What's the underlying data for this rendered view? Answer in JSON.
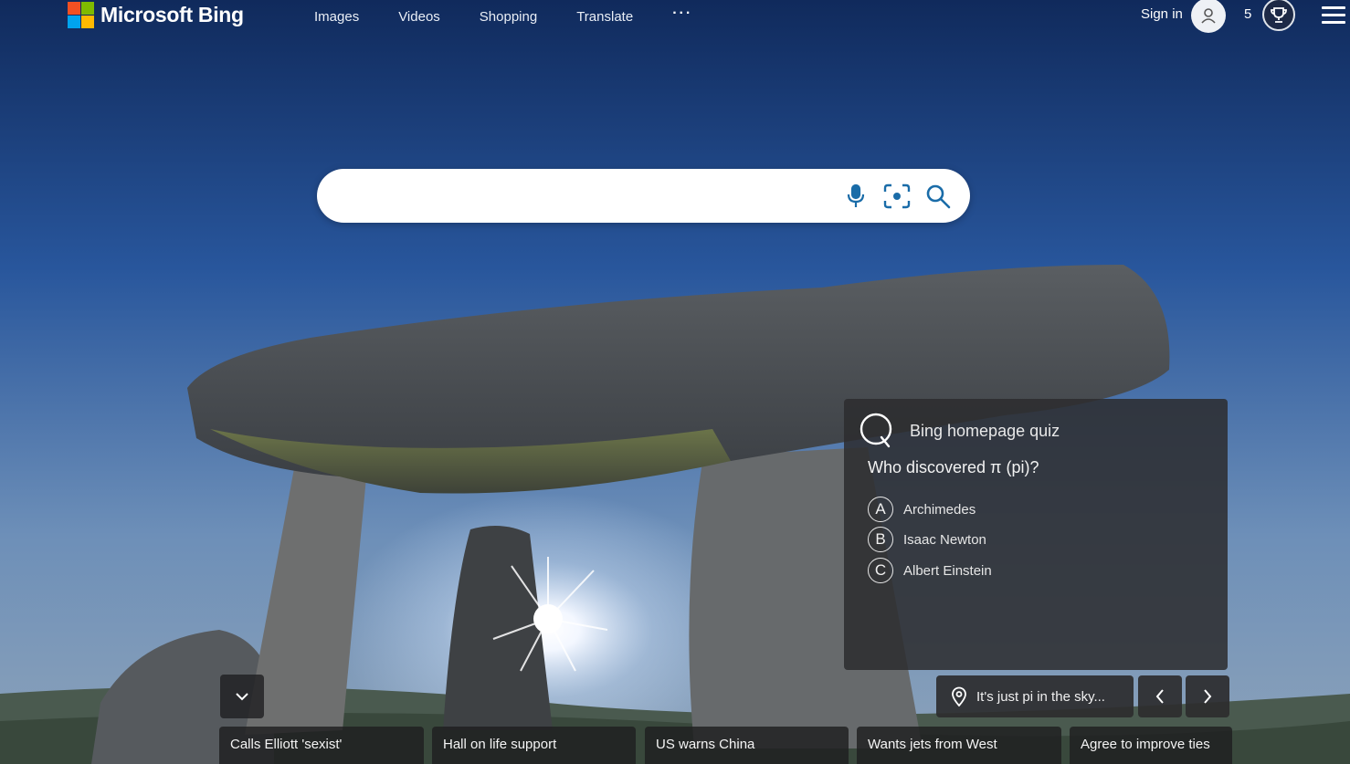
{
  "header": {
    "logo_text": "Microsoft Bing",
    "nav": [
      "Images",
      "Videos",
      "Shopping",
      "Translate"
    ],
    "more_label": "···",
    "signin_label": "Sign in",
    "rewards_points": "5"
  },
  "search": {
    "value": "",
    "placeholder": ""
  },
  "quiz": {
    "title": "Bing homepage quiz",
    "question": "Who discovered π (pi)?",
    "options": [
      {
        "letter": "A",
        "text": "Archimedes"
      },
      {
        "letter": "B",
        "text": "Isaac Newton"
      },
      {
        "letter": "C",
        "text": "Albert Einstein"
      }
    ]
  },
  "image_info": {
    "caption": "It's just pi in the sky..."
  },
  "news": [
    "Calls Elliott 'sexist'",
    "Hall on life support",
    "US warns China",
    "Wants jets from West",
    "Agree to improve ties"
  ],
  "colors": {
    "accent": "#1a6ca8",
    "ms_red": "#f25022",
    "ms_green": "#7fba00",
    "ms_blue": "#00a4ef",
    "ms_yellow": "#ffb900"
  },
  "icons": {
    "logo": "microsoft-logo-icon",
    "user": "user-icon",
    "rewards": "trophy-icon",
    "menu": "hamburger-icon",
    "voice": "microphone-icon",
    "visual_search": "camera-search-icon",
    "search": "search-icon",
    "quiz": "quiz-icon",
    "location": "location-pin-icon",
    "collapse": "chevron-down-icon",
    "prev": "chevron-left-icon",
    "next": "chevron-right-icon"
  }
}
